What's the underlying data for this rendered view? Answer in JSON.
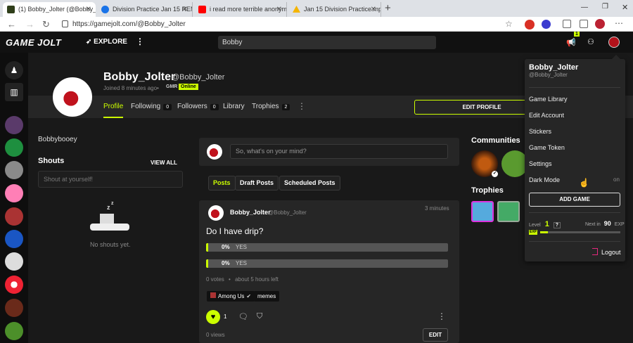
{
  "browser": {
    "tabs": [
      {
        "title": "(1) Bobby_Jolter (@Bobby_Jolte",
        "color": "#2f3e1a"
      },
      {
        "title": "Division Practice Jan 15 REMOTE",
        "color": "#1a73e8"
      },
      {
        "title": "i read more terrible anonymous",
        "color": "#ff0000"
      },
      {
        "title": "Jan 15 Division Practice.mp4 - G",
        "color": "#f4b400"
      }
    ],
    "url": "https://gamejolt.com/@Bobby_Jolter",
    "new_tab": "+"
  },
  "site": {
    "logo": "GAME JOLT",
    "explore": "EXPLORE",
    "search_value": "Bobby",
    "notif_count": "1"
  },
  "profile": {
    "display_name": "Bobby_Jolter",
    "handle": "@Bobby_Jolter",
    "joined": "Joined 8 minutes ago",
    "gmr": "GMR",
    "status": "Online",
    "bio": "Bobbybooey",
    "nav": {
      "profile": "Profile",
      "following": "Following",
      "following_count": "0",
      "followers": "Followers",
      "followers_count": "0",
      "library": "Library",
      "trophies": "Trophies",
      "trophies_count": "2"
    },
    "edit_profile": "EDIT PROFILE"
  },
  "shouts": {
    "heading": "Shouts",
    "view_all": "VIEW ALL",
    "placeholder": "Shout at yourself!",
    "empty": "No shouts yet."
  },
  "feed": {
    "composer_placeholder": "So, what's on your mind?",
    "tabs": [
      "Posts",
      "Draft Posts",
      "Scheduled Posts"
    ],
    "post": {
      "author": "Bobby_Jolter",
      "handle": "@Bobby_Jolter",
      "time": "3 minutes",
      "text": "Do I have drip?",
      "poll": [
        {
          "pct": "0%",
          "label": "YES",
          "fraction": 0
        },
        {
          "pct": "0%",
          "label": "YES",
          "fraction": 0
        }
      ],
      "votes": "0 votes",
      "time_left": "about 5 hours left",
      "community": "Among Us",
      "tag": "memes",
      "likes": "1",
      "edit": "EDIT",
      "views": "0 views"
    }
  },
  "right": {
    "communities": "Communities",
    "trophies": "Trophies"
  },
  "dropdown": {
    "name": "Bobby_Jolter",
    "handle": "@Bobby_Jolter",
    "items": [
      "Game Library",
      "Edit Account",
      "Stickers",
      "Game Token",
      "Settings",
      "Dark Mode"
    ],
    "dark_mode_state": "on",
    "add_game": "ADD GAME",
    "level_label": "Level",
    "level": "1",
    "level_help": "?",
    "next_label": "Next in",
    "next_value": "90",
    "exp": "EXP",
    "exp_fraction": 0.1,
    "logout": "Logout"
  }
}
